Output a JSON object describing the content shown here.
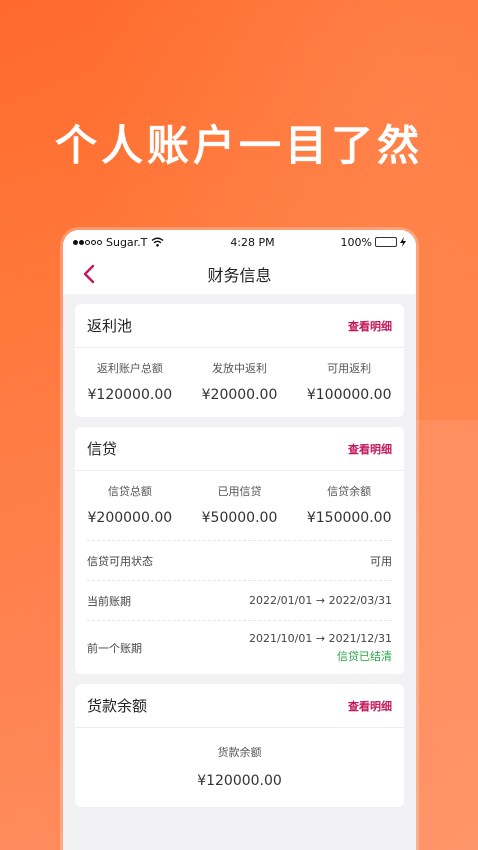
{
  "headline": "个人账户一目了然",
  "status_bar": {
    "carrier": "Sugar.T",
    "time": "4:28 PM",
    "battery": "100%"
  },
  "nav": {
    "title": "财务信息"
  },
  "rebate_pool": {
    "title": "返利池",
    "detail_label": "查看明细",
    "stats": [
      {
        "label": "返利账户总额",
        "value": "¥120000.00"
      },
      {
        "label": "发放中返利",
        "value": "¥20000.00"
      },
      {
        "label": "可用返利",
        "value": "¥100000.00"
      }
    ]
  },
  "credit": {
    "title": "信贷",
    "detail_label": "查看明细",
    "stats": [
      {
        "label": "信贷总额",
        "value": "¥200000.00"
      },
      {
        "label": "已用信贷",
        "value": "¥50000.00"
      },
      {
        "label": "信贷余额",
        "value": "¥150000.00"
      }
    ],
    "rows": [
      {
        "label": "信贷可用状态",
        "value": "可用"
      },
      {
        "label": "当前账期",
        "value": "2022/01/01 → 2022/03/31"
      },
      {
        "label": "前一个账期",
        "value": "2021/10/01 → 2021/12/31",
        "note": "信贷已结清"
      }
    ]
  },
  "payment_balance": {
    "title": "货款余额",
    "detail_label": "查看明细",
    "label": "货款余额",
    "value": "¥120000.00"
  },
  "colors": {
    "accent": "#c2185b",
    "settled": "#27a844",
    "background": "#ff7a3a"
  }
}
